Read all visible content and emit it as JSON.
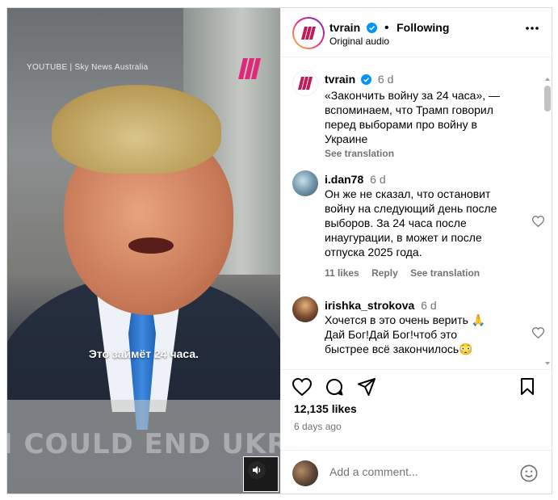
{
  "video": {
    "source_label": "YOUTUBE | Sky News Australia",
    "subtitle": "Это займёт 24 часа.",
    "background_caption": "I COULD END UKR"
  },
  "header": {
    "username": "tvrain",
    "separator": "•",
    "follow_status": "Following",
    "audio_label": "Original audio",
    "more_icon": "more-horizontal-icon"
  },
  "comments": [
    {
      "username": "tvrain",
      "time": "6 d",
      "text": "«Закончить войну за 24 часа», — вспоминаем, что Трамп говорил перед выборами про войну в Украине",
      "see_translation": "See translation"
    },
    {
      "username": "i.dan78",
      "time": "6 d",
      "text": "Он же не сказал, что остановит войну на следующий день после выборов. За 24 часа после инаугурации, в может и после отпуска 2025 года.",
      "likes": "11 likes",
      "reply": "Reply",
      "see_translation": "See translation"
    },
    {
      "username": "irishka_strokova",
      "time": "6 d",
      "text": "Хочется в это очень верить 🙏 Дай Бог!Дай Бог!чтоб это быстрее всё закончилось😳"
    }
  ],
  "actions": {
    "likes": "12,135 likes",
    "date": "6 days ago"
  },
  "add_comment": {
    "placeholder": "Add a comment..."
  },
  "colors": {
    "brand_magenta": "#c2185b",
    "verified_blue": "#0095f6",
    "muted": "#737373",
    "border": "#dbdbdb"
  }
}
